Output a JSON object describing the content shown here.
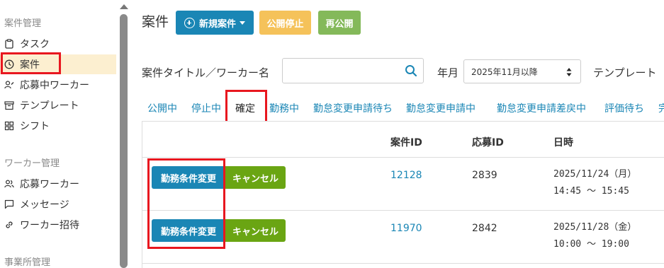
{
  "sidebar": {
    "sections": [
      {
        "title": "案件管理",
        "items": [
          {
            "label": "タスク",
            "icon": "clipboard-icon"
          },
          {
            "label": "案件",
            "icon": "clock-icon",
            "active": true
          },
          {
            "label": "応募中ワーカー",
            "icon": "user-edit-icon"
          },
          {
            "label": "テンプレート",
            "icon": "archive-icon"
          },
          {
            "label": "シフト",
            "icon": "grid-icon"
          }
        ]
      },
      {
        "title": "ワーカー管理",
        "items": [
          {
            "label": "応募ワーカー",
            "icon": "users-icon"
          },
          {
            "label": "メッセージ",
            "icon": "message-icon"
          },
          {
            "label": "ワーカー招待",
            "icon": "link-icon"
          }
        ]
      },
      {
        "title": "事業所管理",
        "items": []
      }
    ]
  },
  "header": {
    "title": "案件",
    "new_button": "新規案件",
    "stop_button": "公開停止",
    "republish_button": "再公開"
  },
  "filters": {
    "search_label": "案件タイトル／ワーカー名",
    "search_value": "",
    "month_label": "年月",
    "month_value": "2025年11月以降",
    "template_label": "テンプレート"
  },
  "tabs": [
    "公開中",
    "停止中",
    "確定",
    "勤務中",
    "勤怠変更申請待ち",
    "勤怠変更申請中",
    "勤怠変更申請差戻中",
    "評価待ち",
    "完"
  ],
  "active_tab": "確定",
  "table": {
    "headers": [
      "案件ID",
      "応募ID",
      "日時"
    ],
    "rows": [
      {
        "edit": "勤務条件変更",
        "cancel": "キャンセル",
        "job_id": "12128",
        "app_id": "2839",
        "date": "2025/11/24（月）",
        "time": "14:45 ～ 15:45"
      },
      {
        "edit": "勤務条件変更",
        "cancel": "キャンセル",
        "job_id": "11970",
        "app_id": "2842",
        "date": "2025/11/28（金）",
        "time": "10:00 ～ 19:00"
      }
    ]
  },
  "colors": {
    "primary": "#1a86b5",
    "warning": "#f5c25a",
    "success": "#84b95a",
    "cancel": "#6aa513",
    "active_bg": "#fcefd0",
    "highlight": "#e8171f"
  }
}
